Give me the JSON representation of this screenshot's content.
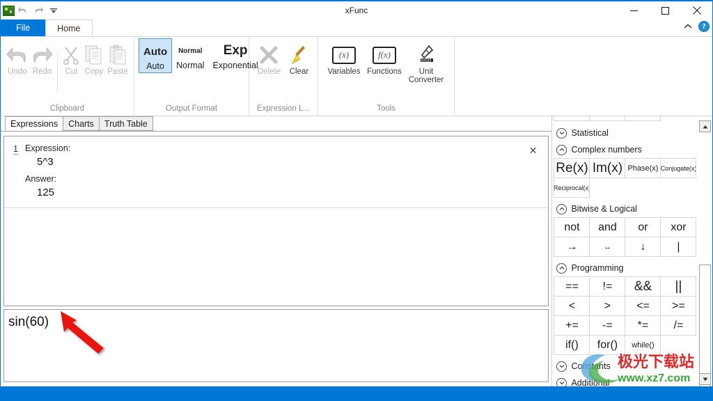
{
  "window": {
    "title": "xFunc",
    "minimize_label": "─",
    "maximize_label": "□",
    "close_label": "✕"
  },
  "quick_access": {
    "app_icon": "app-icon",
    "undo_icon": "undo-icon",
    "redo_icon": "redo-icon",
    "customize_icon": "chevron-down-icon"
  },
  "ribbon_tabs": {
    "file": "File",
    "home": "Home",
    "collapse_icon": "chevron-up-icon",
    "help_label": "?"
  },
  "ribbon": {
    "groups": [
      {
        "label": "Clipboard",
        "buttons": [
          {
            "caption": "Undo",
            "icon": "undo-icon",
            "disabled": true
          },
          {
            "caption": "Redo",
            "icon": "redo-icon",
            "disabled": true
          },
          {
            "caption": "Cut",
            "icon": "scissors-icon",
            "disabled": true
          },
          {
            "caption": "Copy",
            "icon": "copy-icon",
            "disabled": true
          },
          {
            "caption": "Paste",
            "icon": "paste-icon",
            "disabled": true
          }
        ]
      },
      {
        "label": "Output Format",
        "buttons": [
          {
            "caption": "Auto",
            "top": "Auto",
            "selected": true
          },
          {
            "caption": "Normal",
            "top": "Normal",
            "selected": false
          },
          {
            "caption": "Exponential",
            "top": "Exp",
            "selected": false
          }
        ]
      },
      {
        "label": "Expression L...",
        "buttons": [
          {
            "caption": "Delete",
            "icon": "delete-x-icon",
            "disabled": true
          },
          {
            "caption": "Clear",
            "icon": "broom-icon",
            "disabled": false
          }
        ]
      },
      {
        "label": "Tools",
        "buttons": [
          {
            "caption": "Variables",
            "icon": "variables-x-icon",
            "glyph": "(x)"
          },
          {
            "caption": "Functions",
            "icon": "functions-fx-icon",
            "glyph": "f(x)"
          },
          {
            "caption": "Unit Converter",
            "icon": "ruler-icon",
            "glyph": ""
          }
        ]
      }
    ]
  },
  "tabs": [
    {
      "label": "Expressions",
      "active": true
    },
    {
      "label": "Charts",
      "active": false
    },
    {
      "label": "Truth Table",
      "active": false
    }
  ],
  "expressions": [
    {
      "index": "1",
      "expression_label": "Expression:",
      "expression_value": "5^3",
      "answer_label": "Answer:",
      "answer_value": "125",
      "close_label": "✕"
    }
  ],
  "input": {
    "value": "sin(60)",
    "placeholder": ""
  },
  "function_panel": {
    "partial_row": [
      "",
      "",
      ""
    ],
    "sections": [
      {
        "name": "Statistical",
        "expanded": false,
        "chevron": "chevron-down-icon",
        "rows": []
      },
      {
        "name": "Complex numbers",
        "expanded": true,
        "chevron": "chevron-up-icon",
        "rows": [
          [
            {
              "label": "Re(x)",
              "size": "big"
            },
            {
              "label": "Im(x)",
              "size": "big"
            },
            {
              "label": "Phase(x)",
              "size": "small"
            },
            {
              "label": "Conjugate(x)",
              "size": "tiny"
            }
          ],
          [
            {
              "label": "Reciprocal(x)",
              "size": "tiny"
            }
          ]
        ]
      },
      {
        "name": "Bitwise & Logical",
        "expanded": true,
        "chevron": "chevron-up-icon",
        "rows": [
          [
            {
              "label": "not",
              "size": "med"
            },
            {
              "label": "and",
              "size": "med"
            },
            {
              "label": "or",
              "size": "med"
            },
            {
              "label": "xor",
              "size": "med"
            }
          ],
          [
            {
              "label": "→",
              "size": "med"
            },
            {
              "label": "↔",
              "size": "small"
            },
            {
              "label": "↓",
              "size": "med"
            },
            {
              "label": "|",
              "size": "med"
            }
          ]
        ]
      },
      {
        "name": "Programming",
        "expanded": true,
        "chevron": "chevron-up-icon",
        "rows": [
          [
            {
              "label": "==",
              "size": "med"
            },
            {
              "label": "!=",
              "size": "med"
            },
            {
              "label": "&&",
              "size": "big"
            },
            {
              "label": "||",
              "size": "big"
            }
          ],
          [
            {
              "label": "<",
              "size": "med"
            },
            {
              "label": ">",
              "size": "med"
            },
            {
              "label": "<=",
              "size": "med"
            },
            {
              "label": ">=",
              "size": "med"
            }
          ],
          [
            {
              "label": "+=",
              "size": "med"
            },
            {
              "label": "-=",
              "size": "med"
            },
            {
              "label": "*=",
              "size": "med"
            },
            {
              "label": "/=",
              "size": "med"
            }
          ],
          [
            {
              "label": "if()",
              "size": "med"
            },
            {
              "label": "for()",
              "size": "med"
            },
            {
              "label": "while()",
              "size": "small"
            }
          ]
        ]
      },
      {
        "name": "Constants",
        "expanded": false,
        "chevron": "chevron-down-icon",
        "rows": []
      },
      {
        "name": "Additional",
        "expanded": false,
        "chevron": "chevron-down-icon",
        "rows": []
      }
    ],
    "scrollbar": {
      "up_arrow": "▲",
      "down_arrow": "▼"
    }
  },
  "annotation": {
    "arrow_color": "#e8170f",
    "points_to": "sin(60)"
  },
  "watermark": {
    "text_cn": "极光下载站",
    "text_url": "www.xz7.com"
  },
  "colors": {
    "accent": "#0078d7",
    "selected_fill": "#cce4f7",
    "selected_border": "#4a9ad4",
    "panel_border": "#9a9a9a"
  }
}
